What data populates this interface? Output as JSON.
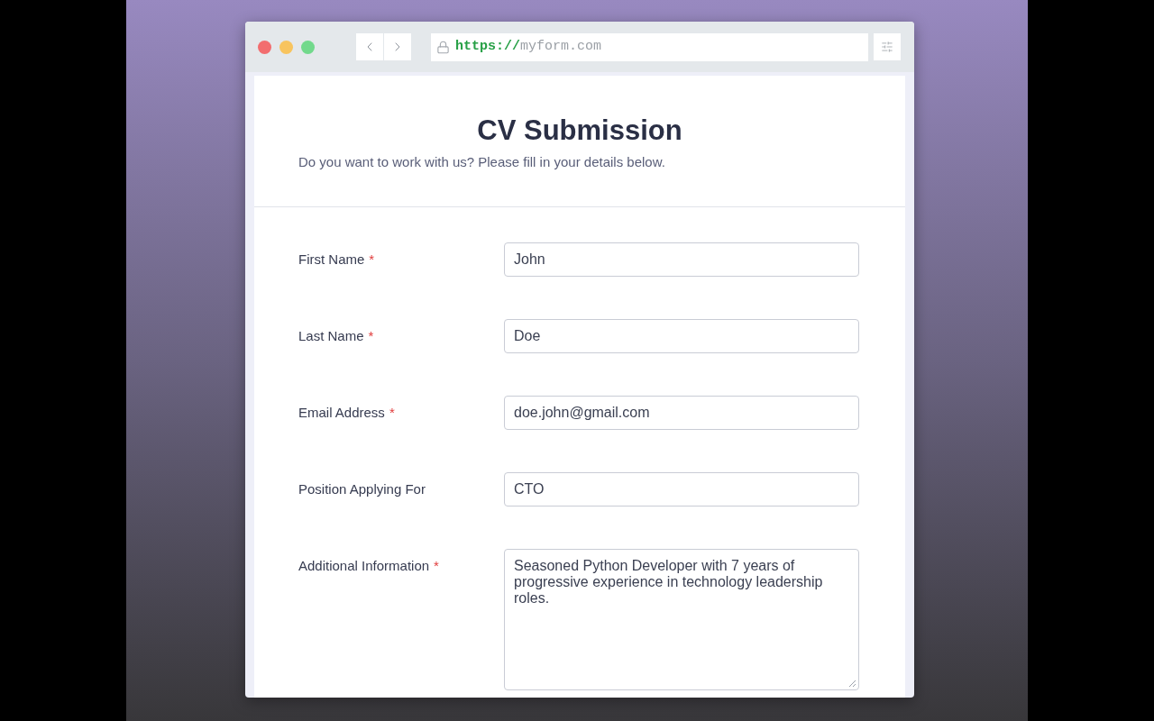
{
  "address_bar": {
    "scheme": "https://",
    "host": "myform.com"
  },
  "form": {
    "title": "CV Submission",
    "subtitle": "Do you want to work with us? Please fill in your details below.",
    "fields": [
      {
        "kind": "input",
        "label": "First Name",
        "required_mark": "*",
        "value": "John"
      },
      {
        "kind": "input",
        "label": "Last Name",
        "required_mark": "*",
        "value": "Doe"
      },
      {
        "kind": "input",
        "label": "Email Address",
        "required_mark": "*",
        "value": "doe.john@gmail.com"
      },
      {
        "kind": "input",
        "label": "Position Applying For",
        "value": "CTO"
      },
      {
        "kind": "textarea",
        "label": "Additional Information",
        "required_mark": "*",
        "value": "Seasoned Python Developer with 7 years of progressive experience in technology leadership roles."
      }
    ]
  }
}
